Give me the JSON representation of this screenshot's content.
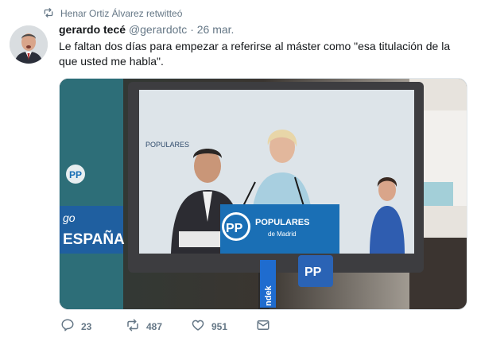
{
  "retweet": {
    "text": "Henar Ortiz Álvarez retwitteó",
    "icon": "retweet-icon"
  },
  "tweet": {
    "author_name": "gerardo tecé",
    "handle": "@gerardotc",
    "separator": "·",
    "date": "26 mar.",
    "text": "Le faltan dos días para empezar a referirse al máster como \"esa titulación de la que usted me habla\"."
  },
  "media": {
    "tv_brand": "PP",
    "backdrop_label": "POPULARES",
    "podium_line1": "POPULARES",
    "podium_line2": "de Madrid",
    "left_banner": "ESPAÑA",
    "left_banner_small": "go",
    "side_sign": "PP",
    "light_sign": "ndek"
  },
  "actions": {
    "reply_count": "23",
    "retweet_count": "487",
    "like_count": "951",
    "icons": [
      "reply-icon",
      "retweet-icon",
      "like-icon",
      "message-icon"
    ]
  },
  "colors": {
    "muted": "#657786",
    "text": "#14171a",
    "pp_blue": "#1a6fb5"
  }
}
